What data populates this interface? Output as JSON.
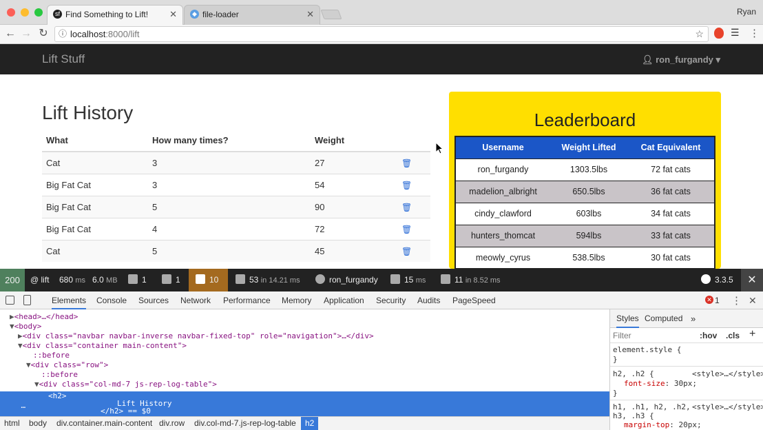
{
  "browser": {
    "tabs": [
      {
        "title": "Find Something to Lift!",
        "active": true
      },
      {
        "title": "file-loader",
        "active": false
      }
    ],
    "profile_name": "Ryan",
    "url_host": "localhost",
    "url_path": ":8000/lift"
  },
  "site": {
    "brand": "Lift Stuff",
    "user": "ron_furgandy ▾"
  },
  "history": {
    "title": "Lift History",
    "columns": [
      "What",
      "How many times?",
      "Weight"
    ],
    "rows": [
      {
        "what": "Cat",
        "times": "3",
        "weight": "27"
      },
      {
        "what": "Big Fat Cat",
        "times": "3",
        "weight": "54"
      },
      {
        "what": "Big Fat Cat",
        "times": "5",
        "weight": "90"
      },
      {
        "what": "Big Fat Cat",
        "times": "4",
        "weight": "72"
      },
      {
        "what": "Cat",
        "times": "5",
        "weight": "45"
      }
    ]
  },
  "leaderboard": {
    "title": "Leaderboard",
    "columns": [
      "Username",
      "Weight Lifted",
      "Cat Equivalent"
    ],
    "rows": [
      {
        "user": "ron_furgandy",
        "weight": "1303.5lbs",
        "cats": "72 fat cats"
      },
      {
        "user": "madelion_albright",
        "weight": "650.5lbs",
        "cats": "36 fat cats"
      },
      {
        "user": "cindy_clawford",
        "weight": "603lbs",
        "cats": "34 fat cats"
      },
      {
        "user": "hunters_thomcat",
        "weight": "594lbs",
        "cats": "33 fat cats"
      },
      {
        "user": "meowly_cyrus",
        "weight": "538.5lbs",
        "cats": "30 fat cats"
      }
    ],
    "colors": {
      "background": "#ffdf00",
      "header": "#1b56c7",
      "stripe": "#c9c4c8"
    }
  },
  "symfony_toolbar": {
    "status": "200",
    "route": "@ lift",
    "time": "680",
    "time_unit": "ms",
    "memory": "6.0",
    "memory_unit": "MB",
    "forms": "1",
    "logs": "1",
    "errors": "10",
    "twig_count": "53",
    "twig_time": "in 14.21 ms",
    "user": "ron_furgandy",
    "request_time": "15",
    "request_unit": "ms",
    "db_count": "11",
    "db_time": "in 8.52 ms",
    "version": "3.3.5",
    "status_color": "#4f805d",
    "errors_color": "#a46a1f"
  },
  "devtools": {
    "tabs": [
      "Elements",
      "Console",
      "Sources",
      "Network",
      "Performance",
      "Memory",
      "Application",
      "Security",
      "Audits",
      "PageSpeed"
    ],
    "error_count": "1",
    "breadcrumbs": [
      "html",
      "body",
      "div.container.main-content",
      "div.row",
      "div.col-md-7.js-rep-log-table",
      "h2"
    ],
    "dom": {
      "head": "<head>…</head>",
      "body": "<body>",
      "nav_div": "<div class=\"navbar navbar-inverse navbar-fixed-top\" role=\"navigation\">…</div>",
      "container": "<div class=\"container main-content\">",
      "before1": "::before",
      "row": "<div class=\"row\">",
      "before2": "::before",
      "col": "<div class=\"col-md-7 js-rep-log-table\">",
      "h2_open": "<h2>",
      "h2_text": "Lift History",
      "h2_close": "</h2> == $0"
    },
    "styles": {
      "tabs": [
        "Styles",
        "Computed"
      ],
      "filter_placeholder": "Filter",
      "hov": ":hov",
      "cls": ".cls",
      "rule1": "element.style {",
      "rule1_close": "}",
      "rule2_selector": "h2, .h2 {",
      "rule2_source": "<style>…</style>",
      "rule2_prop": "font-size",
      "rule2_val": "30px;",
      "rule2_close": "}",
      "rule3_selector": "h1, .h1, h2, .h2,",
      "rule3_selector2": "h3, .h3 {",
      "rule3_source": "<style>…</style>",
      "rule3_prop": "margin-top",
      "rule3_val": "20px;"
    }
  }
}
